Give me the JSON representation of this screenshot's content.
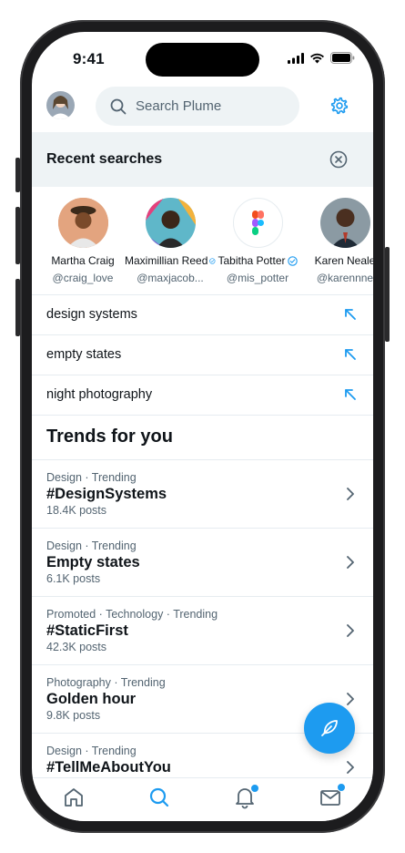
{
  "status_bar": {
    "time": "9:41"
  },
  "header": {
    "search_placeholder": "Search Plume",
    "avatar_icon": "user-avatar",
    "settings_icon": "gear-icon"
  },
  "recent": {
    "title": "Recent searches",
    "profiles": [
      {
        "name": "Martha Craig",
        "handle": "@craig_love",
        "verified": false
      },
      {
        "name": "Maximillian Reed",
        "handle": "@maxjacob...",
        "verified": true
      },
      {
        "name": "Tabitha Potter",
        "handle": "@mis_potter",
        "verified": true
      },
      {
        "name": "Karen Neale",
        "handle": "@karennne",
        "verified": false
      }
    ],
    "searches": [
      {
        "text": "design systems"
      },
      {
        "text": "empty states"
      },
      {
        "text": "night photography"
      }
    ]
  },
  "trends": {
    "title": "Trends for you",
    "items": [
      {
        "meta": "Design · Trending",
        "name": "#DesignSystems",
        "count": "18.4K posts"
      },
      {
        "meta": "Design · Trending",
        "name": "Empty states",
        "count": "6.1K posts"
      },
      {
        "meta": "Promoted · Technology · Trending",
        "name": "#StaticFirst",
        "count": "42.3K posts"
      },
      {
        "meta": "Photography · Trending",
        "name": "Golden hour",
        "count": "9.8K posts"
      },
      {
        "meta": "Design · Trending",
        "name": "#TellMeAboutYou",
        "count": ""
      }
    ]
  },
  "tabbar": {
    "tabs": [
      {
        "icon": "home-icon",
        "active": false,
        "badge": false
      },
      {
        "icon": "search-icon",
        "active": true,
        "badge": false
      },
      {
        "icon": "bell-icon",
        "active": false,
        "badge": true
      },
      {
        "icon": "mail-icon",
        "active": false,
        "badge": true
      }
    ]
  },
  "colors": {
    "accent": "#1d9bf0",
    "text_primary": "#0f1419",
    "text_secondary": "#536471",
    "surface": "#eef3f5"
  }
}
